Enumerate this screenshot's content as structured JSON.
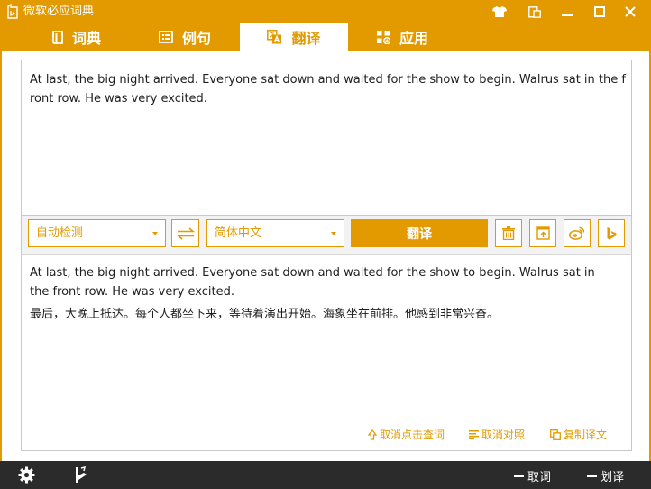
{
  "window": {
    "title": "微软必应词典"
  },
  "tabs": [
    {
      "label": "词典",
      "icon": "book-icon"
    },
    {
      "label": "例句",
      "icon": "document-icon"
    },
    {
      "label": "翻译",
      "icon": "translate-icon",
      "active": true
    },
    {
      "label": "应用",
      "icon": "apps-icon"
    }
  ],
  "source": {
    "text": "At last, the big night arrived. Everyone sat down and waited for the show to begin. Walrus sat in the front row. He was very excited."
  },
  "controls": {
    "source_lang": "自动检测",
    "target_lang": "简体中文",
    "translate_label": "翻译"
  },
  "result": {
    "source_text": "At last, the big night arrived. Everyone sat down and waited for the show to begin. Walrus sat in the front row. He was very excited.",
    "translation": "最后，大晚上抵达。每个人都坐下来，等待着演出开始。海象坐在前排。他感到非常兴奋。",
    "links": [
      {
        "label": "取消点击查词",
        "icon": "up-arrow-icon"
      },
      {
        "label": "取消对照",
        "icon": "lines-icon"
      },
      {
        "label": "复制译文",
        "icon": "copy-icon"
      }
    ]
  },
  "bottom_bar": {
    "toggle_1": "取词",
    "toggle_2": "划译"
  },
  "colors": {
    "accent": "#e29a00",
    "bottom_bar": "#2b2b2b"
  }
}
